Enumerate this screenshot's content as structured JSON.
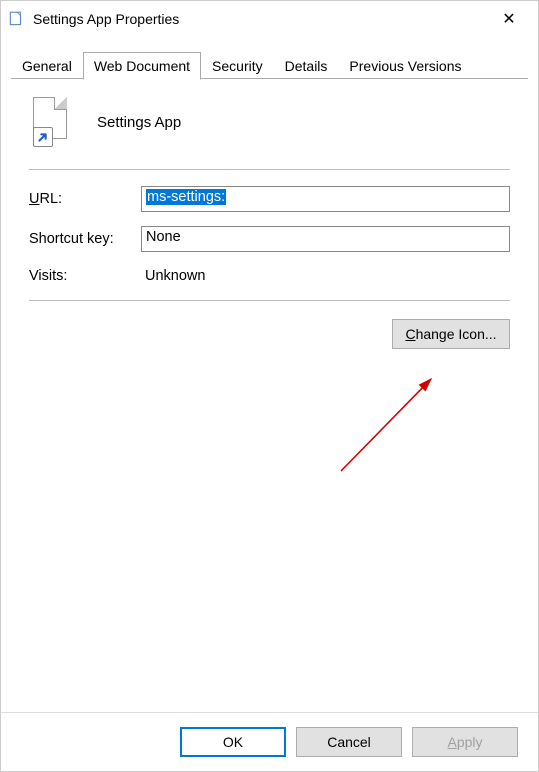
{
  "window": {
    "title": "Settings App Properties"
  },
  "tabs": {
    "items": [
      {
        "label": "General"
      },
      {
        "label": "Web Document"
      },
      {
        "label": "Security"
      },
      {
        "label": "Details"
      },
      {
        "label": "Previous Versions"
      }
    ],
    "active_index": 1
  },
  "header": {
    "app_name": "Settings App"
  },
  "fields": {
    "url": {
      "label_prefix": "U",
      "label_rest": "RL:",
      "value": "ms-settings:"
    },
    "shortcut_key": {
      "label": "Shortcut key:",
      "value": "None"
    },
    "visits": {
      "label": "Visits:",
      "value": "Unknown"
    }
  },
  "buttons": {
    "change_icon_prefix": "C",
    "change_icon_rest": "hange Icon...",
    "ok": "OK",
    "cancel": "Cancel",
    "apply_prefix": "A",
    "apply_rest": "pply"
  }
}
